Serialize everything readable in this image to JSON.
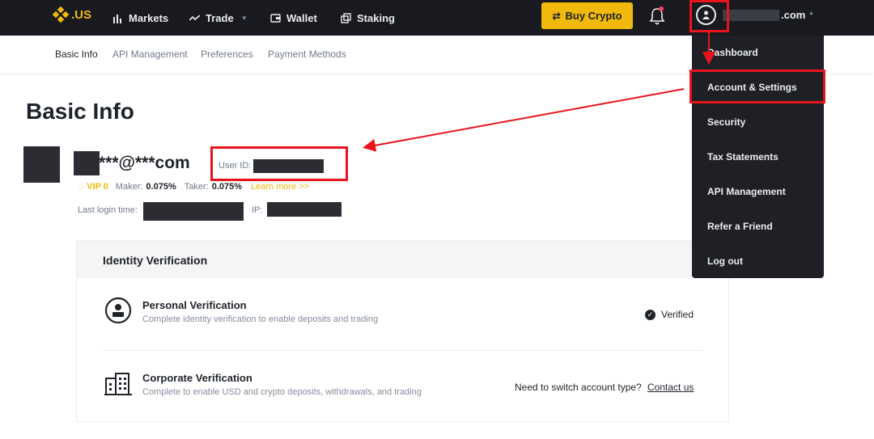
{
  "brand": {
    "logo_text": ".US",
    "accent": "#f0b90b"
  },
  "nav": {
    "markets": "Markets",
    "trade": "Trade",
    "wallet": "Wallet",
    "staking": "Staking",
    "buy_crypto": "Buy Crypto",
    "email_suffix": ".com"
  },
  "subnav": {
    "items": [
      "Basic Info",
      "API Management",
      "Preferences",
      "Payment Methods"
    ]
  },
  "dropdown": {
    "items": [
      "Dashboard",
      "Account & Settings",
      "Security",
      "Tax Statements",
      "API Management",
      "Refer a Friend",
      "Log out"
    ]
  },
  "profile": {
    "page_title": "Basic Info",
    "email": "***@***com",
    "user_id_label": "User ID:",
    "vip": "VIP 0",
    "maker_label": "Maker:",
    "maker_value": "0.075%",
    "taker_label": "Taker:",
    "taker_value": "0.075%",
    "learn_more": "Learn more >>",
    "last_login_label": "Last login time:",
    "ip_label": "IP:"
  },
  "identity": {
    "title": "Identity Verification",
    "personal_title": "Personal Verification",
    "personal_sub": "Complete identity verification to enable deposits and trading",
    "personal_status": "Verified",
    "corporate_title": "Corporate Verification",
    "corporate_sub": "Complete to enable USD and crypto deposits, withdrawals, and trading",
    "switch_text": "Need to switch account type?",
    "contact_text": "Contact us"
  },
  "annotation_color": "#e8141c"
}
